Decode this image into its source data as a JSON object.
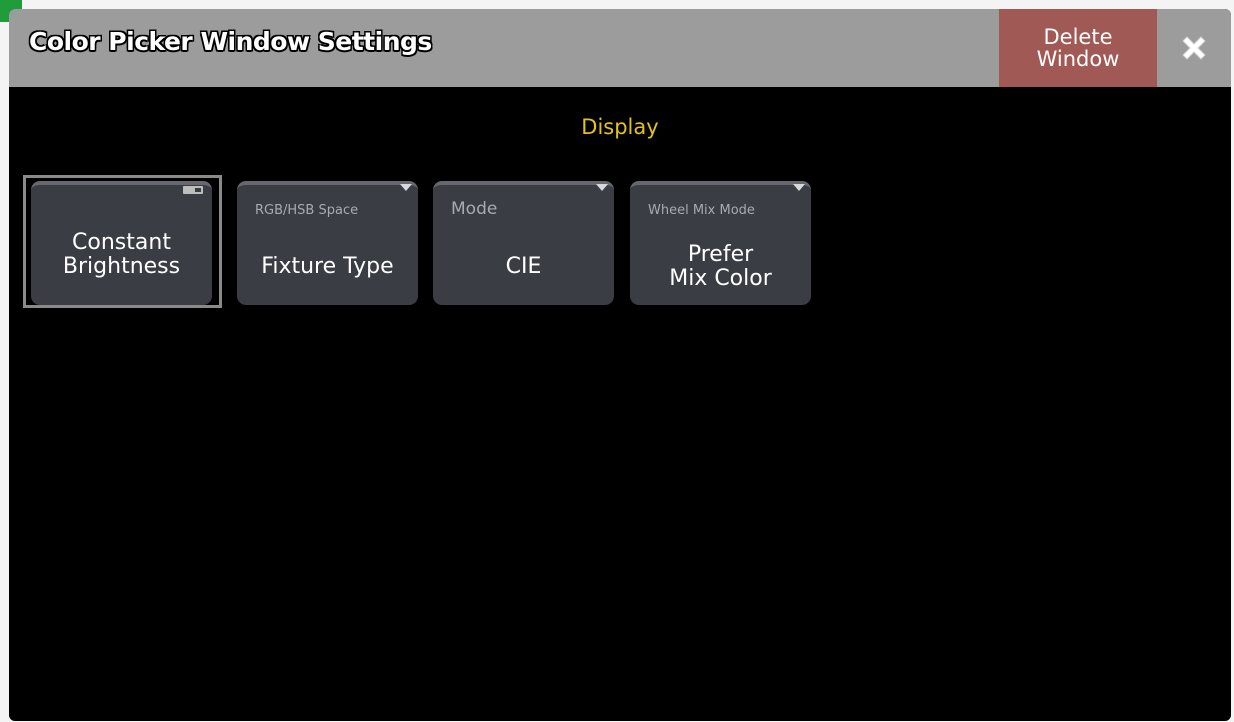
{
  "window": {
    "title": "Color Picker Window Settings",
    "delete_label": "Delete\nWindow",
    "close_icon": "close-icon"
  },
  "section": {
    "title": "Display"
  },
  "tiles": [
    {
      "label": "",
      "value": "Constant\nBrightness",
      "control": "toggle",
      "selected": true
    },
    {
      "label": "RGB/HSB Space",
      "value": "Fixture Type",
      "control": "dropdown"
    },
    {
      "label": "Mode",
      "value": "CIE",
      "control": "dropdown"
    },
    {
      "label": "Wheel Mix Mode",
      "value": "Prefer\nMix Color",
      "control": "dropdown"
    }
  ],
  "colors": {
    "titlebar": "#9c9c9c",
    "delete_button": "#a05955",
    "section_title": "#e3c21c",
    "tile": "#3b3d44",
    "background": "#000000"
  }
}
